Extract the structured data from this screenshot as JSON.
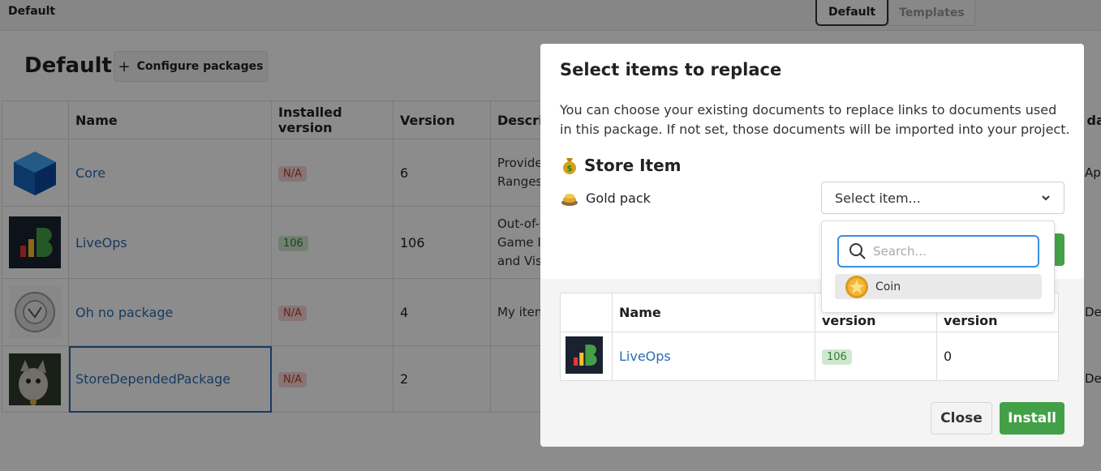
{
  "topbar": {
    "crumb": "Default",
    "tabs": [
      {
        "label": "Default"
      },
      {
        "label": "Templates"
      }
    ]
  },
  "page": {
    "title": "Default",
    "configure_label": "Configure packages"
  },
  "table": {
    "headers": [
      "Name",
      "Installed version",
      "Version",
      "Descrip"
    ],
    "rows": [
      {
        "name": "Core",
        "installed": "N/A",
        "version": "6",
        "desc": "Provide\nRanges"
      },
      {
        "name": "LiveOps",
        "installed": "106",
        "version": "106",
        "desc": "Out-of-\nGame I\nand Vis"
      },
      {
        "name": "Oh no package",
        "installed": "N/A",
        "version": "4",
        "desc": "My iten"
      },
      {
        "name": "StoreDependedPackage",
        "installed": "N/A",
        "version": "2",
        "desc": ""
      }
    ],
    "right_fragments": [
      "da",
      "Ap",
      "De",
      "De"
    ]
  },
  "install_dialog": {
    "headers": [
      "Name",
      "Installed version",
      "Needed version"
    ],
    "row": {
      "name": "LiveOps",
      "installed": "106",
      "needed": "0"
    },
    "close_label": "Close",
    "install_label": "Install"
  },
  "modal": {
    "title": "Select items to replace",
    "description": "You can choose your existing documents to replace links to documents used in this package. If not set, those documents will be imported into your project.",
    "section": {
      "icon": "money-bag-icon",
      "label": "Store Item"
    },
    "item": {
      "icon": "gold-pack-icon",
      "label": "Gold pack"
    },
    "select": {
      "value": "Select item..."
    },
    "dropdown": {
      "placeholder": "Search...",
      "options": [
        {
          "icon": "coin-icon",
          "label": "Coin"
        }
      ]
    }
  },
  "colors": {
    "accent": "#3a8ee6",
    "primary_green": "#43a047",
    "link": "#2a6bb3",
    "badge_na_bg": "#f6d6d6",
    "badge_ok_bg": "#cfe8cf"
  }
}
